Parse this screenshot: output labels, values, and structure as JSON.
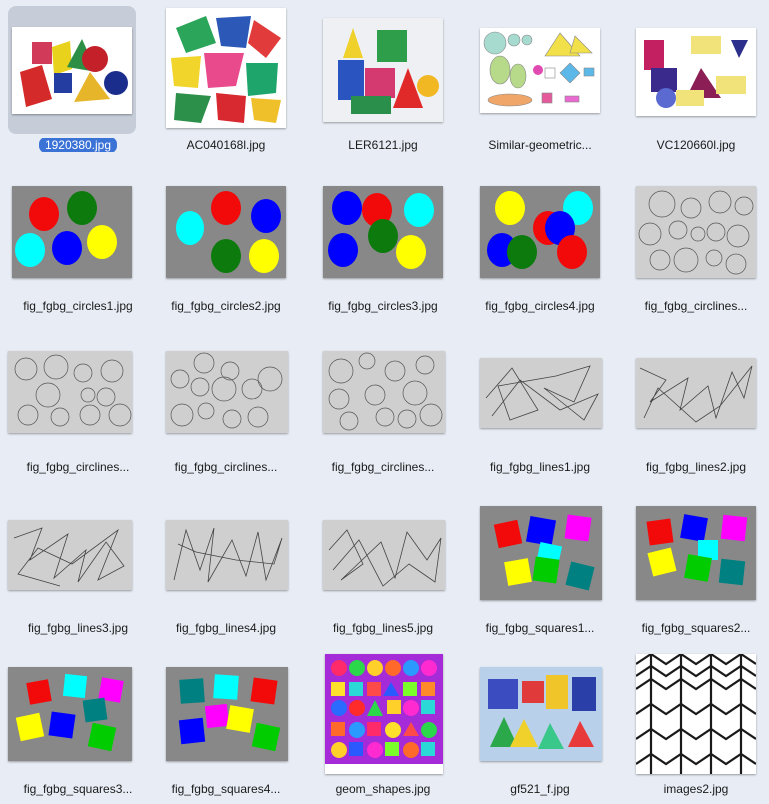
{
  "window": {
    "title": ""
  },
  "selection": {
    "selected_index": 0,
    "selection_color": "#3b72d6"
  },
  "files": [
    {
      "name": "1920380.jpg",
      "icon": "image-file-icon"
    },
    {
      "name": "AC040168l.jpg",
      "icon": "image-file-icon"
    },
    {
      "name": "LER6121.jpg",
      "icon": "image-file-icon"
    },
    {
      "name": "Similar-geometric...",
      "icon": "image-file-icon"
    },
    {
      "name": "VC120660l.jpg",
      "icon": "image-file-icon"
    },
    {
      "name": "fig_fgbg_circles1.jpg",
      "icon": "image-file-icon"
    },
    {
      "name": "fig_fgbg_circles2.jpg",
      "icon": "image-file-icon"
    },
    {
      "name": "fig_fgbg_circles3.jpg",
      "icon": "image-file-icon"
    },
    {
      "name": "fig_fgbg_circles4.jpg",
      "icon": "image-file-icon"
    },
    {
      "name": "fig_fgbg_circlines...",
      "icon": "image-file-icon"
    },
    {
      "name": "fig_fgbg_circlines...",
      "icon": "image-file-icon"
    },
    {
      "name": "fig_fgbg_circlines...",
      "icon": "image-file-icon"
    },
    {
      "name": "fig_fgbg_circlines...",
      "icon": "image-file-icon"
    },
    {
      "name": "fig_fgbg_lines1.jpg",
      "icon": "image-file-icon"
    },
    {
      "name": "fig_fgbg_lines2.jpg",
      "icon": "image-file-icon"
    },
    {
      "name": "fig_fgbg_lines3.jpg",
      "icon": "image-file-icon"
    },
    {
      "name": "fig_fgbg_lines4.jpg",
      "icon": "image-file-icon"
    },
    {
      "name": "fig_fgbg_lines5.jpg",
      "icon": "image-file-icon"
    },
    {
      "name": "fig_fgbg_squares1...",
      "icon": "image-file-icon"
    },
    {
      "name": "fig_fgbg_squares2...",
      "icon": "image-file-icon"
    },
    {
      "name": "fig_fgbg_squares3...",
      "icon": "image-file-icon"
    },
    {
      "name": "fig_fgbg_squares4...",
      "icon": "image-file-icon"
    },
    {
      "name": "geom_shapes.jpg",
      "icon": "image-file-icon"
    },
    {
      "name": "gf521_f.jpg",
      "icon": "image-file-icon"
    },
    {
      "name": "images2.jpg",
      "icon": "image-file-icon"
    }
  ]
}
